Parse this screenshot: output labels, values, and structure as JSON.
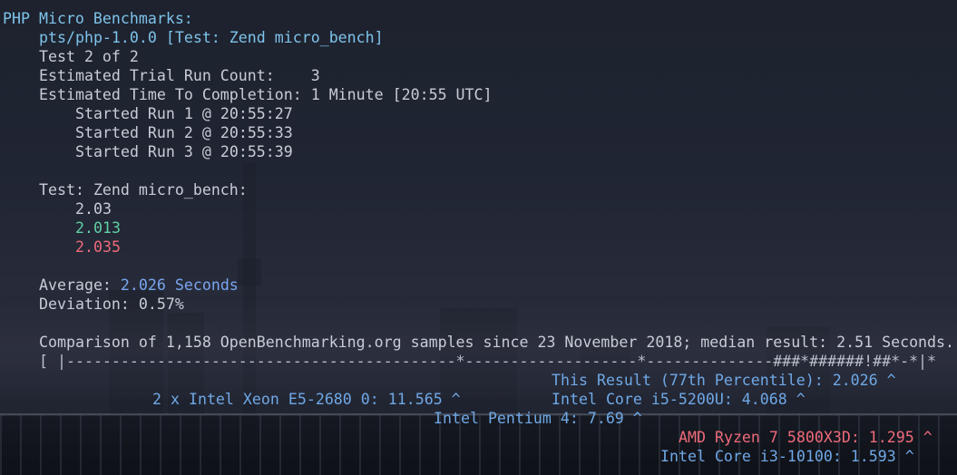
{
  "header": {
    "title": "PHP Micro Benchmarks:",
    "test_profile": "pts/php-1.0.0 [Test: Zend micro_bench]",
    "test_count": "Test 2 of 2",
    "trial_run_count": "Estimated Trial Run Count:    3",
    "time_to_completion": "Estimated Time To Completion: 1 Minute [20:55 UTC]"
  },
  "runs": [
    "Started Run 1 @ 20:55:27",
    "Started Run 2 @ 20:55:33",
    "Started Run 3 @ 20:55:39"
  ],
  "results": {
    "heading": "Test: Zend micro_bench:",
    "values": [
      "2.03",
      "2.013",
      "2.035"
    ]
  },
  "summary": {
    "average_label": "Average: ",
    "average_value": "2.026 Seconds",
    "deviation": "Deviation: 0.57%"
  },
  "comparison": {
    "text": "Comparison of 1,158 OpenBenchmarking.org samples since 23 November 2018; median result: 2.51 Seconds.",
    "bar": "[ |-------------------------------------------*-------------------*--------------###*######!##*-*|*",
    "this_result": "This Result (77th Percentile): 2.026 ^",
    "xeon": "2 x Intel Xeon E5-2680 0: 11.565 ^",
    "i5": "Intel Core i5-5200U: 4.068 ^",
    "pentium": "Intel Pentium 4: 7.69 ^",
    "ryzen": "AMD Ryzen 7 5800X3D: 1.295 ^",
    "i3": "Intel Core i3-10100: 1.593 ^"
  },
  "colors": {
    "title": "#7ec3ea",
    "text": "#c7ccd6",
    "green": "#5fd0a5",
    "red": "#ee6a7a",
    "blue": "#79a6f0"
  }
}
